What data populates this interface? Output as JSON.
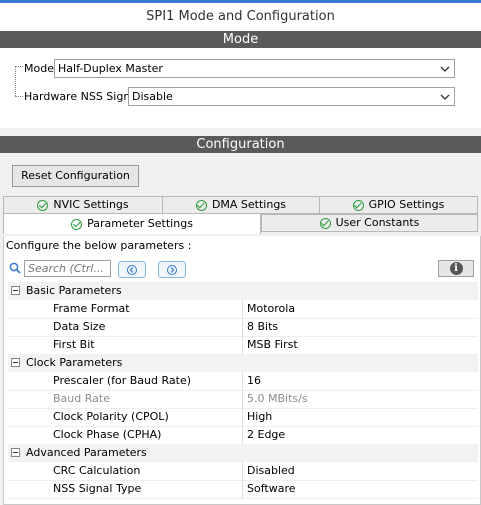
{
  "window": {
    "title": "SPI1 Mode and Configuration"
  },
  "mode": {
    "header": "Mode",
    "fields": [
      {
        "label": "Mode",
        "value": "Half-Duplex Master"
      },
      {
        "label": "Hardware NSS Signal",
        "value": "Disable"
      }
    ]
  },
  "configuration": {
    "header": "Configuration",
    "reset_button": "Reset Configuration",
    "tabs_row1": [
      "NVIC Settings",
      "DMA Settings",
      "GPIO Settings"
    ],
    "tabs_row2": [
      "Parameter Settings",
      "User Constants"
    ],
    "active_tab": "Parameter Settings",
    "configure_text": "Configure the below parameters :",
    "search_placeholder": "Search (Ctrl...",
    "groups": [
      {
        "name": "Basic Parameters",
        "params": [
          {
            "key": "Frame Format",
            "value": "Motorola"
          },
          {
            "key": "Data Size",
            "value": "8 Bits"
          },
          {
            "key": "First Bit",
            "value": "MSB First"
          }
        ]
      },
      {
        "name": "Clock Parameters",
        "params": [
          {
            "key": "Prescaler (for Baud Rate)",
            "value": "16"
          },
          {
            "key": "Baud Rate",
            "value": "5.0 MBits/s"
          },
          {
            "key": "Clock Polarity (CPOL)",
            "value": "High"
          },
          {
            "key": "Clock Phase (CPHA)",
            "value": "2 Edge"
          }
        ]
      },
      {
        "name": "Advanced Parameters",
        "params": [
          {
            "key": "CRC Calculation",
            "value": "Disabled"
          },
          {
            "key": "NSS Signal Type",
            "value": "Software"
          }
        ]
      }
    ]
  },
  "colors": {
    "header_bar": "#5a5a5a",
    "check_green": "#2e9e3e",
    "accent": "#3a7bd5"
  }
}
